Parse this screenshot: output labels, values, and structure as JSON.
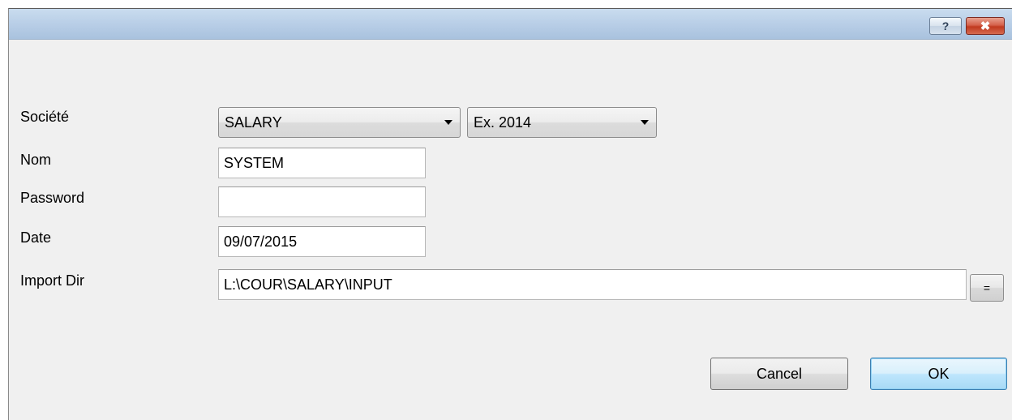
{
  "titlebar": {
    "help_label": "?",
    "close_label": "✖"
  },
  "form": {
    "societe": {
      "label": "Société",
      "company_value": "SALARY",
      "year_value": "Ex. 2014"
    },
    "nom": {
      "label": "Nom",
      "value": "SYSTEM"
    },
    "password": {
      "label": "Password",
      "value": ""
    },
    "date": {
      "label": "Date",
      "value": "09/07/2015"
    },
    "import_dir": {
      "label": "Import Dir",
      "value": "L:\\COUR\\SALARY\\INPUT",
      "browse_label": "="
    }
  },
  "buttons": {
    "cancel_label": "Cancel",
    "ok_label": "OK"
  },
  "icons": {
    "help": "help-question-icon",
    "close": "close-x-icon",
    "dropdown": "chevron-down-icon"
  },
  "colors": {
    "titlebar": "#b7cde6",
    "close_button": "#c0391f",
    "ok_border": "#3c7fb1",
    "dialog_bg": "#f0f0f0"
  }
}
